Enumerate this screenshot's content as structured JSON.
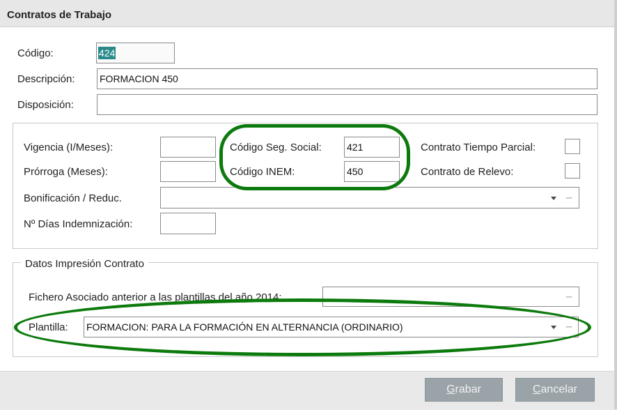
{
  "window": {
    "title": "Contratos de Trabajo"
  },
  "header_fields": {
    "codigo_label": "Código:",
    "codigo_value": "424",
    "descripcion_label": "Descripción:",
    "descripcion_value": "FORMACION 450",
    "disposicion_label": "Disposición:",
    "disposicion_value": ""
  },
  "contract_group": {
    "vigencia_label": "Vigencia (I/Meses):",
    "vigencia_value": "",
    "prorroga_label": "Prórroga (Meses):",
    "prorroga_value": "",
    "bonificacion_label": "Bonificación / Reduc.",
    "bonificacion_value": "",
    "dias_label": "Nº Días Indemnización:",
    "dias_value": "",
    "seg_social_label": "Código Seg. Social:",
    "seg_social_value": "421",
    "inem_label": "Código INEM:",
    "inem_value": "450",
    "tiempo_parcial_label": "Contrato Tiempo Parcial:",
    "tiempo_parcial_checked": false,
    "relevo_label": "Contrato de Relevo:",
    "relevo_checked": false
  },
  "print_group": {
    "title": "Datos Impresión Contrato",
    "fichero_label": "Fichero Asociado anterior a las plantillas del año 2014:",
    "fichero_value": "",
    "plantilla_label": "Plantilla:",
    "plantilla_value": "FORMACION: PARA LA FORMACIÓN EN ALTERNANCIA (ORDINARIO)"
  },
  "buttons": {
    "grabar_first": "G",
    "grabar_rest": "rabar",
    "cancelar_first": "C",
    "cancelar_rest": "ancelar"
  },
  "icons": {
    "combo": "chevron-down-icon",
    "browse": "ellipsis-icon"
  },
  "colors": {
    "highlight_ellipse": "#0c7a0c",
    "selection": "#2a8a8a",
    "button_disabled": "#9aa3a8"
  }
}
